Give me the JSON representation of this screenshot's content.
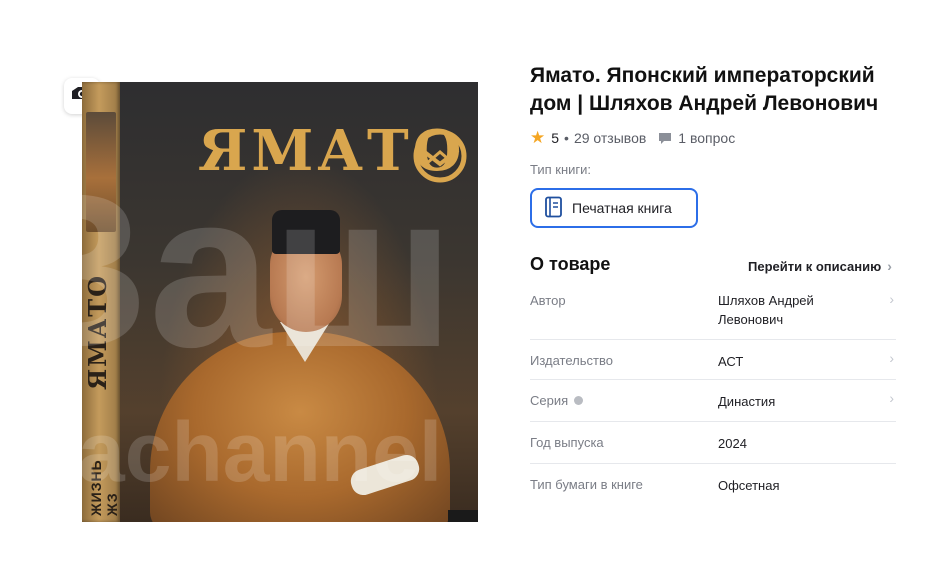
{
  "cover": {
    "title": "ЯМАТО",
    "spine_title": "ЯМАТО",
    "spine_series": "ЖИЗНЬ ЖЗ",
    "watermark_big": "Ваш",
    "watermark_small": "dvachannel"
  },
  "product": {
    "title": "Ямато. Японский императорский дом | Шляхов Андрей Левонович",
    "rating": "5",
    "reviews": "29 отзывов",
    "questions": "1 вопрос",
    "book_type_label": "Тип книги:",
    "book_type_value": "Печатная книга"
  },
  "about": {
    "heading": "О товаре",
    "goto_description": "Перейти к описанию",
    "specs": [
      {
        "label": "Автор",
        "value": "Шляхов Андрей Левонович"
      },
      {
        "label": "Издательство",
        "value": "АСТ"
      },
      {
        "label": "Серия",
        "value": "Династия"
      },
      {
        "label": "Год выпуска",
        "value": "2024"
      },
      {
        "label": "Тип бумаги в книге",
        "value": "Офсетная"
      }
    ]
  },
  "colors": {
    "accent": "#2c6ee8",
    "star": "#f5a623",
    "cover_gold": "#d9a64e"
  }
}
